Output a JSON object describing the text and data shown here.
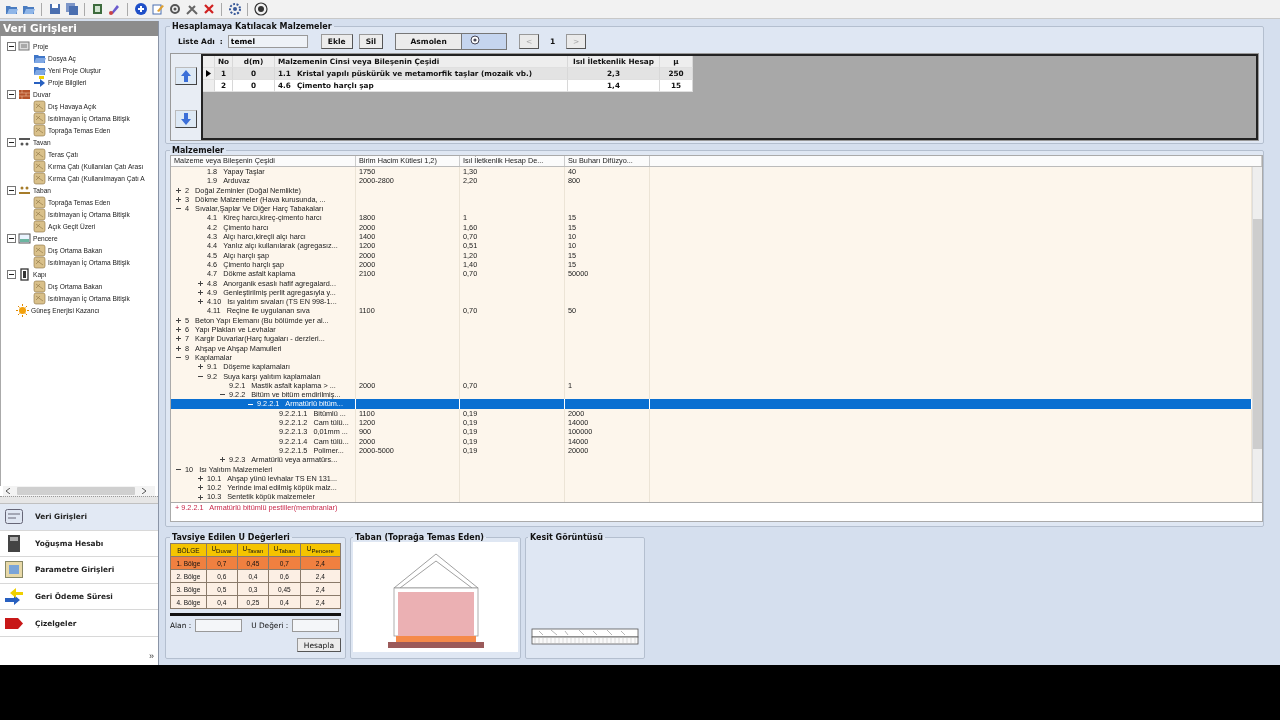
{
  "sidebar": {
    "title": "Veri Girişleri",
    "tree": [
      {
        "label": "Proje",
        "expanded": true,
        "children": [
          {
            "label": "Dosya Aç"
          },
          {
            "label": "Yeni Proje Oluştur"
          },
          {
            "label": "Proje Bilgileri"
          }
        ]
      },
      {
        "label": "Duvar",
        "expanded": true,
        "children": [
          {
            "label": "Dış Havaya Açık"
          },
          {
            "label": "Isıtılmayan İç Ortama Bitişik"
          },
          {
            "label": "Toprağa Temas Eden"
          }
        ]
      },
      {
        "label": "Tavan",
        "expanded": true,
        "children": [
          {
            "label": "Teras Çatı"
          },
          {
            "label": "Kırma Çatı (Kullanılan Çatı Arası"
          },
          {
            "label": "Kırma Çatı (Kullanılmayan Çatı A"
          }
        ]
      },
      {
        "label": "Taban",
        "expanded": true,
        "children": [
          {
            "label": "Toprağa Temas Eden"
          },
          {
            "label": "Isıtılmayan İç Ortama Bitişik"
          },
          {
            "label": "Açık Geçit Üzeri"
          }
        ]
      },
      {
        "label": "Pencere",
        "expanded": true,
        "children": [
          {
            "label": "Dış Ortama Bakan"
          },
          {
            "label": "Isıtılmayan İç Ortama Bitişik"
          }
        ]
      },
      {
        "label": "Kapı",
        "expanded": true,
        "children": [
          {
            "label": "Dış Ortama Bakan"
          },
          {
            "label": "Isıtılmayan İç Ortama Bitişik"
          }
        ]
      },
      {
        "label": "Güneş Enerjisi Kazancı"
      }
    ]
  },
  "nav": {
    "items": [
      {
        "label": "Veri Girişleri",
        "selected": true
      },
      {
        "label": "Yoğuşma Hesabı",
        "selected": false
      },
      {
        "label": "Parametre Girişleri",
        "selected": false
      },
      {
        "label": "Geri Ödeme Süresi",
        "selected": false
      },
      {
        "label": "Çizelgeler",
        "selected": false
      }
    ],
    "more": "»"
  },
  "list_panel": {
    "title": "Hesaplamaya Katılacak Malzemeler",
    "name_label": "Liste Adı",
    "separator": ":",
    "name_value": "temel",
    "buttons": [
      "Ekle",
      "Sil"
    ],
    "toggle": "Asmolen",
    "pager": {
      "prev": "<",
      "page": "1",
      "next": ">"
    },
    "table": {
      "columns": [
        "No",
        "d(m)",
        "Malzemenin Cinsi veya Bileşenin Çeşidi",
        "Isıl İletkenlik Hesap",
        "μ"
      ],
      "rows": [
        {
          "selected": true,
          "no": "1",
          "d": "0",
          "code": "1.1",
          "name": "Kristal yapılı püskürük ve metamorfik taşlar (mozaik vb.)",
          "k": "2,3",
          "mu": "250"
        },
        {
          "selected": false,
          "no": "2",
          "d": "0",
          "code": "4.6",
          "name": "Çimento harçlı şap",
          "k": "1,4",
          "mu": "15"
        }
      ]
    }
  },
  "materials": {
    "title": "Malzemeler",
    "columns": [
      "Malzeme veya Bileşenin Çeşidi",
      "Birim Hacim Kütlesi 1,2)",
      "Isıl İletkenlik Hesap De...",
      "Su Buharı Difüzyo..."
    ],
    "rows": [
      {
        "children": [
          {
            "code": "1.8",
            "name": "Yapay Taşlar",
            "selected": false,
            "values": [
              "1750",
              "1,30",
              "40"
            ]
          },
          {
            "code": "1.9",
            "name": "Arduvaz",
            "selected": false,
            "values": [
              "2000-2800",
              "2,20",
              "800"
            ]
          }
        ]
      },
      {
        "code": "2",
        "name": "Doğal Zeminler (Doğal Nemlikte)",
        "selected": false,
        "expanded": false
      },
      {
        "code": "3",
        "name": "Dökme Malzemeler (Hava kurusunda, ...",
        "selected": false,
        "expanded": false
      },
      {
        "code": "4",
        "name": "Sıvalar,Şaplar Ve Diğer Harç Tabakaları",
        "selected": false,
        "expanded": true,
        "children": [
          {
            "code": "4.1",
            "name": "Kireç harcı,kireç-çimento harcı",
            "selected": false,
            "values": [
              "1800",
              "1",
              "15"
            ]
          },
          {
            "code": "4.2",
            "name": "Çimento harcı",
            "selected": false,
            "values": [
              "2000",
              "1,60",
              "15"
            ]
          },
          {
            "code": "4.3",
            "name": "Alçı harcı,kireçli alçı harcı",
            "selected": false,
            "values": [
              "1400",
              "0,70",
              "10"
            ]
          },
          {
            "code": "4.4",
            "name": "Yanlız alçı kullanılarak (agregasız...",
            "selected": false,
            "values": [
              "1200",
              "0,51",
              "10"
            ]
          },
          {
            "code": "4.5",
            "name": "Alçı harçlı şap",
            "selected": false,
            "values": [
              "2000",
              "1,20",
              "15"
            ]
          },
          {
            "code": "4.6",
            "name": "Çimento harçlı şap",
            "selected": false,
            "values": [
              "2000",
              "1,40",
              "15"
            ]
          },
          {
            "code": "4.7",
            "name": "Dökme asfalt kaplama",
            "selected": false,
            "values": [
              "2100",
              "0,70",
              "50000"
            ]
          },
          {
            "code": "4.8",
            "name": "Anorganik esaslı hafif agregalard...",
            "selected": false,
            "expanded": false
          },
          {
            "code": "4.9",
            "name": "Genleştirilmiş perlit agregasıyla y...",
            "selected": false,
            "expanded": false
          },
          {
            "code": "4.10",
            "name": "Isı yalıtım sıvaları (TS EN 998-1...",
            "selected": false,
            "expanded": false
          },
          {
            "code": "4.11",
            "name": "Reçine ile uygulanan sıva",
            "selected": false,
            "values": [
              "1100",
              "0,70",
              "50"
            ]
          }
        ]
      },
      {
        "code": "5",
        "name": "Beton Yapı Elemanı (Bu bölümde yer al...",
        "selected": false,
        "expanded": false
      },
      {
        "code": "6",
        "name": "Yapı Plakları ve Levhalar",
        "selected": false,
        "expanded": false
      },
      {
        "code": "7",
        "name": "Kargir Duvarlar(Harç fugaları - derzleri...",
        "selected": false,
        "expanded": false
      },
      {
        "code": "8",
        "name": "Ahşap ve Ahşap Mamulleri",
        "selected": false,
        "expanded": false
      },
      {
        "code": "9",
        "name": "Kaplamalar",
        "selected": false,
        "expanded": true,
        "children": [
          {
            "code": "9.1",
            "name": "Döşeme kaplamaları",
            "selected": false,
            "expanded": false
          },
          {
            "code": "9.2",
            "name": "Suya karşı yalıtım kaplamaları",
            "selected": false,
            "expanded": true,
            "children": [
              {
                "code": "9.2.1",
                "name": "Mastik asfalt kaplama > ...",
                "selected": false,
                "values": [
                  "2000",
                  "0,70",
                  "1"
                ]
              },
              {
                "code": "9.2.2",
                "name": "Bitüm ve bitüm emdirilmiş...",
                "selected": false,
                "expanded": true,
                "children": [
                  {
                    "code": "9.2.2.1",
                    "name": "Armatürlü bitüm...",
                    "selected": true,
                    "expanded": true,
                    "children": [
                      {
                        "code": "9.2.2.1.1",
                        "name": "Bitümlü ...",
                        "selected": false,
                        "values": [
                          "1100",
                          "0,19",
                          "2000"
                        ]
                      },
                      {
                        "code": "9.2.2.1.2",
                        "name": "Cam tülü...",
                        "selected": false,
                        "values": [
                          "1200",
                          "0,19",
                          "14000"
                        ]
                      },
                      {
                        "code": "9.2.2.1.3",
                        "name": "0,01mm ...",
                        "selected": false,
                        "values": [
                          "900",
                          "0,19",
                          "100000"
                        ]
                      },
                      {
                        "code": "9.2.2.1.4",
                        "name": "Cam tülü...",
                        "selected": false,
                        "values": [
                          "2000",
                          "0,19",
                          "14000"
                        ]
                      },
                      {
                        "code": "9.2.2.1.5",
                        "name": "Polimer...",
                        "selected": false,
                        "values": [
                          "2000-5000",
                          "0,19",
                          "20000"
                        ]
                      }
                    ]
                  }
                ]
              },
              {
                "code": "9.2.3",
                "name": "Armatürlü veya armatürs...",
                "selected": false,
                "expanded": false
              }
            ]
          }
        ]
      },
      {
        "code": "10",
        "name": "Isı Yalıtım Malzemeleri",
        "selected": false,
        "expanded": true,
        "children": [
          {
            "code": "10.1",
            "name": "Ahşap yünü levhalar TS EN 131...",
            "selected": false,
            "expanded": false
          },
          {
            "code": "10.2",
            "name": "Yerinde imal edilmiş köpük malz...",
            "selected": false,
            "expanded": false
          },
          {
            "code": "10.3",
            "name": "Sentetik köpük malzemeler",
            "selected": false,
            "expanded": false
          }
        ]
      }
    ],
    "status": "+ 9.2.2.1   Armatürlü bitümlü pestiller(membranlar)"
  },
  "u_values": {
    "title": "Tavsiye Edilen U Değerleri",
    "columns": [
      "BÖLGE",
      "U$_{Duvar}$",
      "U$_{Tavan}$",
      "U$_{Taban}$",
      "U$_{Pencere}$"
    ],
    "rows": [
      {
        "selected": true,
        "cells": [
          "1. Bölge",
          "0,7",
          "0,45",
          "0,7",
          "2,4"
        ]
      },
      {
        "selected": false,
        "cells": [
          "2. Bölge",
          "0,6",
          "0,4",
          "0,6",
          "2,4"
        ]
      },
      {
        "selected": false,
        "cells": [
          "3. Bölge",
          "0,5",
          "0,3",
          "0,45",
          "2,4"
        ]
      },
      {
        "selected": false,
        "cells": [
          "4. Bölge",
          "0,4",
          "0,25",
          "0,4",
          "2,4"
        ]
      }
    ],
    "area_label": "Alan :",
    "u_label": "U Değeri  :",
    "button": "Hesapla"
  },
  "floor_view": {
    "title": "Taban (Toprağa Temas Eden)"
  },
  "section_view": {
    "title": "Kesit Görüntüsü"
  }
}
